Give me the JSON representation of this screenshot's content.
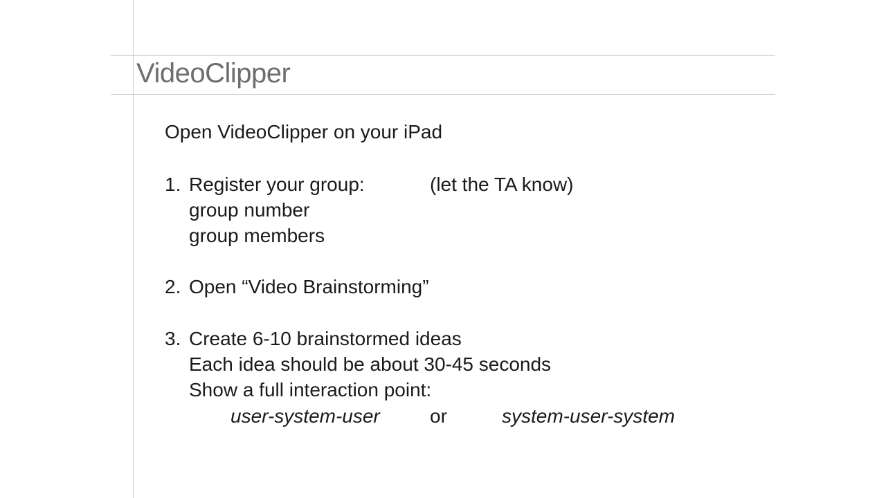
{
  "slide": {
    "title": "VideoClipper",
    "intro": "Open VideoClipper on your iPad",
    "steps": [
      {
        "num": "1.",
        "text": "Register your group:",
        "note": "(let the TA know)",
        "sublines": [
          "group number",
          "group members"
        ]
      },
      {
        "num": "2.",
        "text": "Open “Video Brainstorming”"
      },
      {
        "num": "3.",
        "text": "Create 6-10 brainstormed ideas",
        "sublines": [
          "Each idea should be about 30-45 seconds",
          "Show a full interaction point:"
        ],
        "options": {
          "left": "user-system-user",
          "connector": "or",
          "right": "system-user-system"
        }
      }
    ]
  }
}
